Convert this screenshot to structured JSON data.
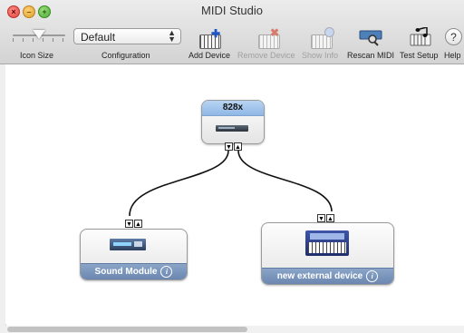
{
  "window": {
    "title": "MIDI Studio"
  },
  "toolbar": {
    "icon_size_label": "Icon Size",
    "configuration_label": "Configuration",
    "configuration_value": "Default",
    "add_device_label": "Add Device",
    "remove_device_label": "Remove Device",
    "show_info_label": "Show Info",
    "rescan_midi_label": "Rescan MIDI",
    "test_setup_label": "Test Setup",
    "help_label": "Help",
    "help_glyph": "?"
  },
  "devices": {
    "interface": {
      "name": "828x"
    },
    "sound_module": {
      "name": "Sound Module",
      "info_glyph": "i"
    },
    "external": {
      "name": "new external device",
      "info_glyph": "i"
    }
  },
  "ports": {
    "out_glyph": "▼",
    "in_glyph": "▲"
  }
}
